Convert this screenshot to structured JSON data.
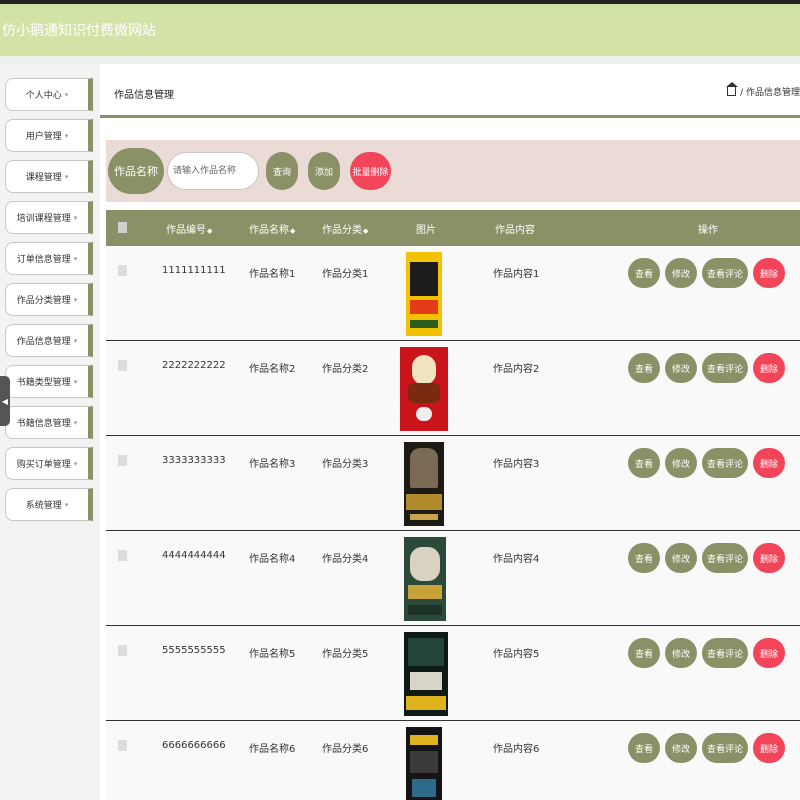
{
  "site_title": "仿小鹅通知识付费微网站",
  "sidebar": {
    "items": [
      {
        "label": "个人中心",
        "caret": "▾"
      },
      {
        "label": "用户管理",
        "caret": "▾"
      },
      {
        "label": "课程管理",
        "caret": "▾"
      },
      {
        "label": "培训课程管理",
        "caret": "▾"
      },
      {
        "label": "订单信息管理",
        "caret": "▾"
      },
      {
        "label": "作品分类管理",
        "caret": "▾"
      },
      {
        "label": "作品信息管理",
        "caret": "▾"
      },
      {
        "label": "书籍类型管理",
        "caret": "▾"
      },
      {
        "label": "书籍信息管理",
        "caret": "▾"
      },
      {
        "label": "购买订单管理",
        "caret": "▾"
      },
      {
        "label": "系统管理",
        "caret": "▾"
      }
    ]
  },
  "header": {
    "page_title": "作品信息管理",
    "breadcrumb": "/ 作品信息管理"
  },
  "search": {
    "label": "作品名称",
    "placeholder": "请输入作品名称",
    "query_button": "查询",
    "add_button": "添加",
    "batch_delete_button": "批量删除"
  },
  "table": {
    "columns": [
      "作品编号",
      "作品名称",
      "作品分类",
      "图片",
      "作品内容",
      "操作"
    ],
    "sort_icon": "◆",
    "rows": [
      {
        "id": "1111111111",
        "name": "作品名称1",
        "category": "作品分类1",
        "content": "作品内容1"
      },
      {
        "id": "2222222222",
        "name": "作品名称2",
        "category": "作品分类2",
        "content": "作品内容2"
      },
      {
        "id": "3333333333",
        "name": "作品名称3",
        "category": "作品分类3",
        "content": "作品内容3"
      },
      {
        "id": "4444444444",
        "name": "作品名称4",
        "category": "作品分类4",
        "content": "作品内容4"
      },
      {
        "id": "5555555555",
        "name": "作品名称5",
        "category": "作品分类5",
        "content": "作品内容5"
      },
      {
        "id": "6666666666",
        "name": "作品名称6",
        "category": "作品分类6",
        "content": "作品内容6"
      }
    ],
    "actions": {
      "view": "查看",
      "edit": "修改",
      "comments": "查看评论",
      "delete": "删除"
    }
  },
  "colors": {
    "accent": "#8b9167",
    "danger": "#f2455a",
    "topbar": "#d3e2a6",
    "search_bg": "#eadbd6"
  }
}
